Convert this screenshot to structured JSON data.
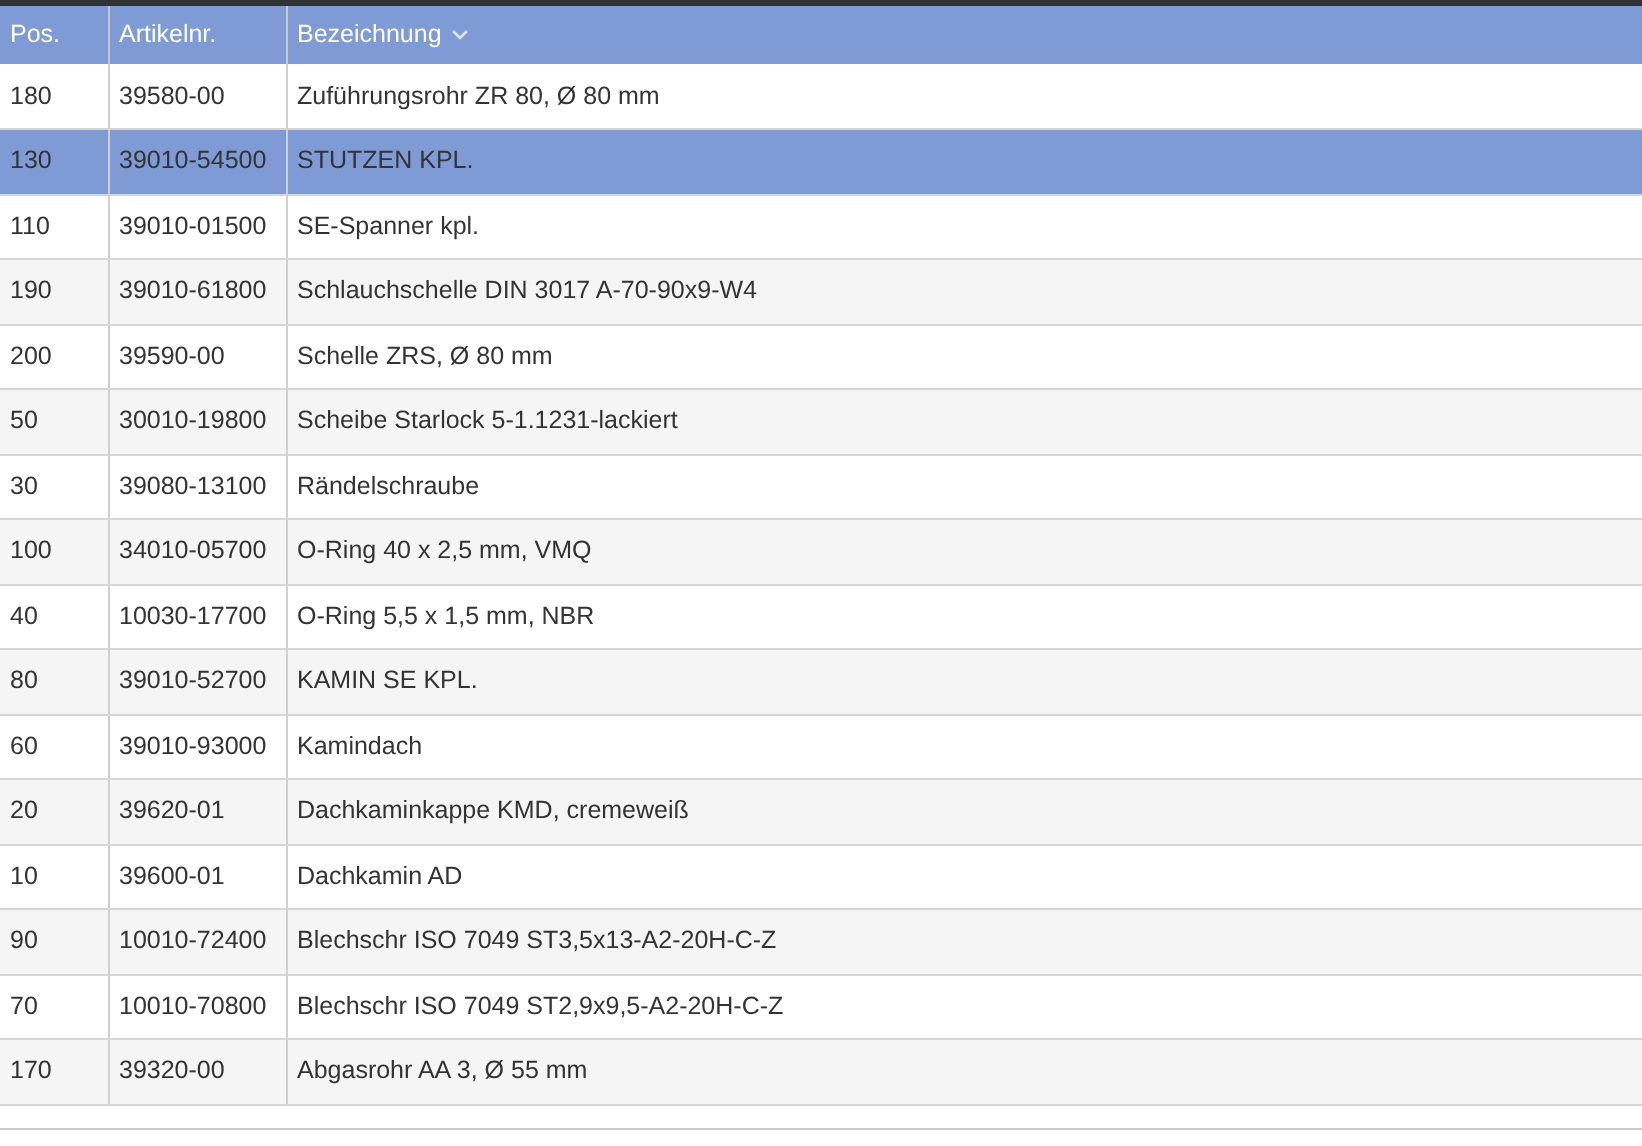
{
  "table": {
    "columns": [
      {
        "label": "Pos.",
        "sorted": false
      },
      {
        "label": "Artikelnr.",
        "sorted": false
      },
      {
        "label": "Bezeichnung",
        "sorted": true
      }
    ],
    "rows": [
      {
        "cells": [
          "180",
          "39580-00",
          "Zuführungsrohr ZR 80, Ø 80 mm"
        ],
        "selected": false
      },
      {
        "cells": [
          "130",
          "39010-54500",
          "STUTZEN KPL."
        ],
        "selected": true
      },
      {
        "cells": [
          "110",
          "39010-01500",
          "SE-Spanner kpl."
        ],
        "selected": false
      },
      {
        "cells": [
          "190",
          "39010-61800",
          "Schlauchschelle DIN 3017 A-70-90x9-W4"
        ],
        "selected": false
      },
      {
        "cells": [
          "200",
          "39590-00",
          "Schelle ZRS, Ø 80 mm"
        ],
        "selected": false
      },
      {
        "cells": [
          "50",
          "30010-19800",
          "Scheibe Starlock 5-1.1231-lackiert"
        ],
        "selected": false
      },
      {
        "cells": [
          "30",
          "39080-13100",
          "Rändelschraube"
        ],
        "selected": false
      },
      {
        "cells": [
          "100",
          "34010-05700",
          "O-Ring 40 x 2,5 mm, VMQ"
        ],
        "selected": false
      },
      {
        "cells": [
          "40",
          "10030-17700",
          "O-Ring 5,5 x 1,5 mm, NBR"
        ],
        "selected": false
      },
      {
        "cells": [
          "80",
          "39010-52700",
          "KAMIN SE KPL."
        ],
        "selected": false
      },
      {
        "cells": [
          "60",
          "39010-93000",
          "Kamindach"
        ],
        "selected": false
      },
      {
        "cells": [
          "20",
          "39620-01",
          "Dachkaminkappe KMD, cremeweiß"
        ],
        "selected": false
      },
      {
        "cells": [
          "10",
          "39600-01",
          "Dachkamin AD"
        ],
        "selected": false
      },
      {
        "cells": [
          "90",
          "10010-72400",
          "Blechschr ISO 7049 ST3,5x13-A2-20H-C-Z"
        ],
        "selected": false
      },
      {
        "cells": [
          "70",
          "10010-70800",
          "Blechschr ISO 7049 ST2,9x9,5-A2-20H-C-Z"
        ],
        "selected": false
      },
      {
        "cells": [
          "170",
          "39320-00",
          "Abgasrohr AA 3, Ø 55 mm"
        ],
        "selected": false
      }
    ]
  }
}
